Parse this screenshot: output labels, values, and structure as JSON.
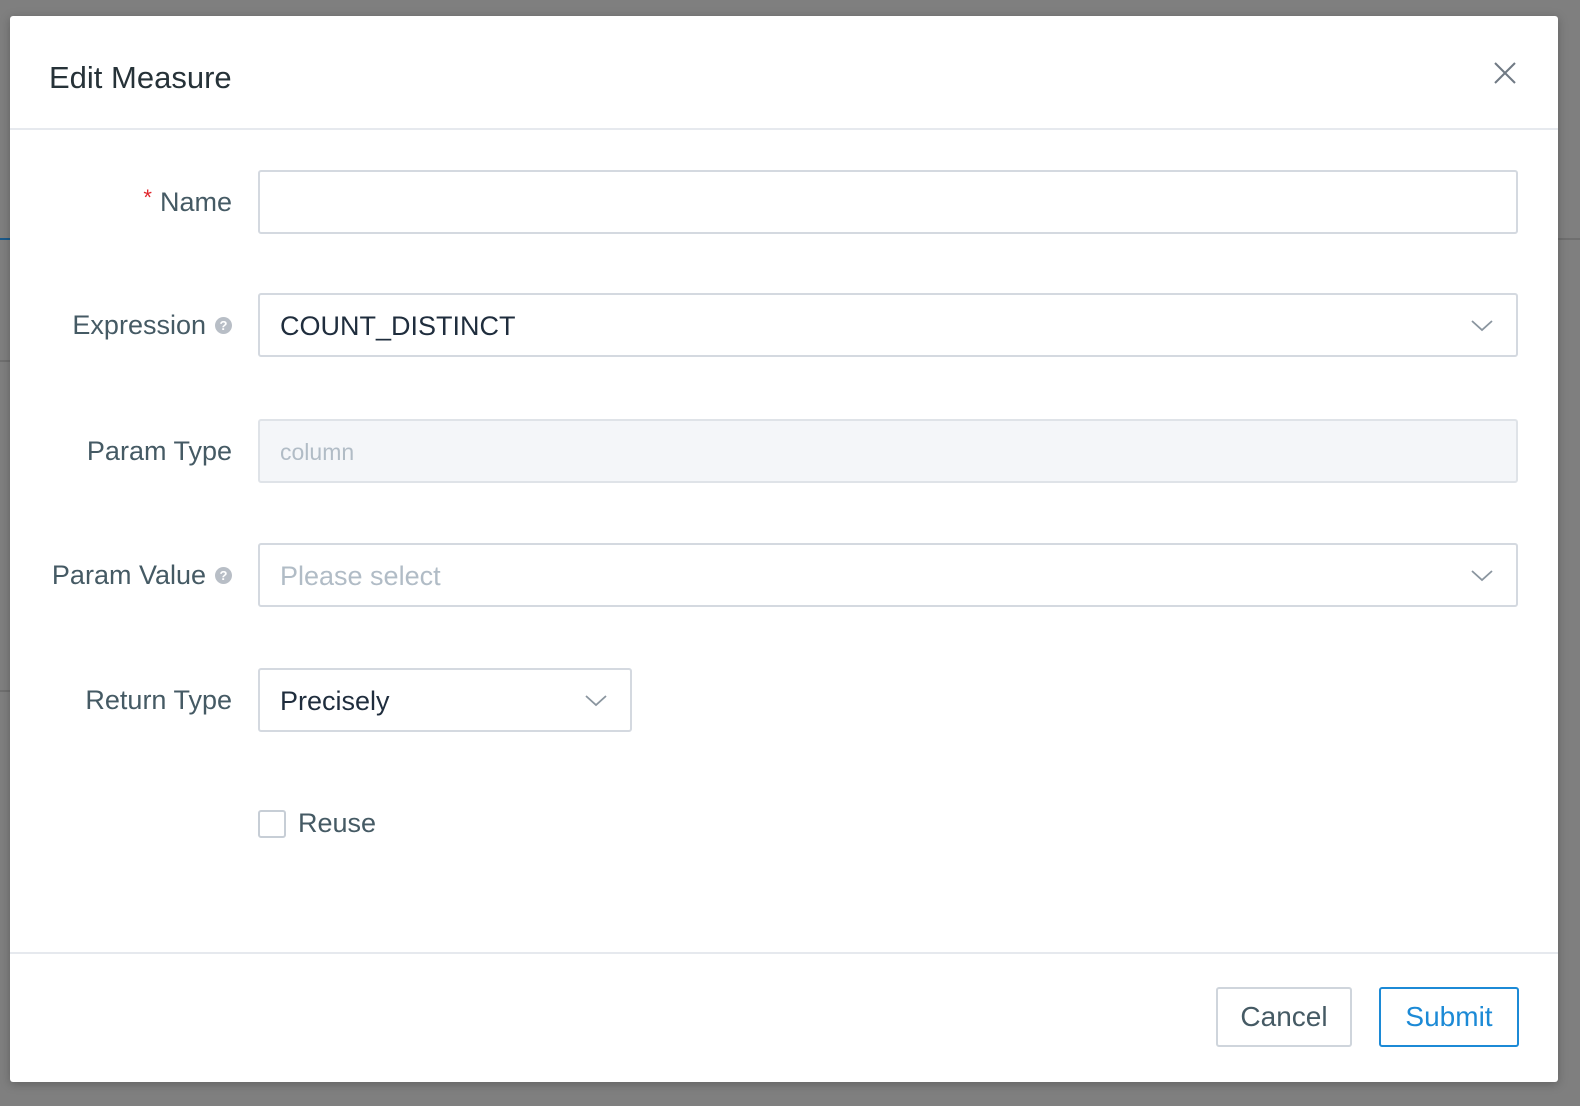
{
  "modal": {
    "title": "Edit Measure"
  },
  "form": {
    "name": {
      "label": "Name",
      "required_mark": "*",
      "value": "",
      "placeholder": ""
    },
    "expression": {
      "label": "Expression",
      "help_icon": "question-circle-icon",
      "value": "COUNT_DISTINCT"
    },
    "param_type": {
      "label": "Param Type",
      "value": "column"
    },
    "param_value": {
      "label": "Param Value",
      "help_icon": "question-circle-icon",
      "placeholder": "Please select"
    },
    "return_type": {
      "label": "Return Type",
      "value": "Precisely"
    },
    "reuse": {
      "label": "Reuse",
      "checked": false
    }
  },
  "footer": {
    "cancel_label": "Cancel",
    "submit_label": "Submit"
  },
  "colors": {
    "primary": "#1c8ad6",
    "required": "#e0262c",
    "overlay": "#7f7f7f"
  }
}
